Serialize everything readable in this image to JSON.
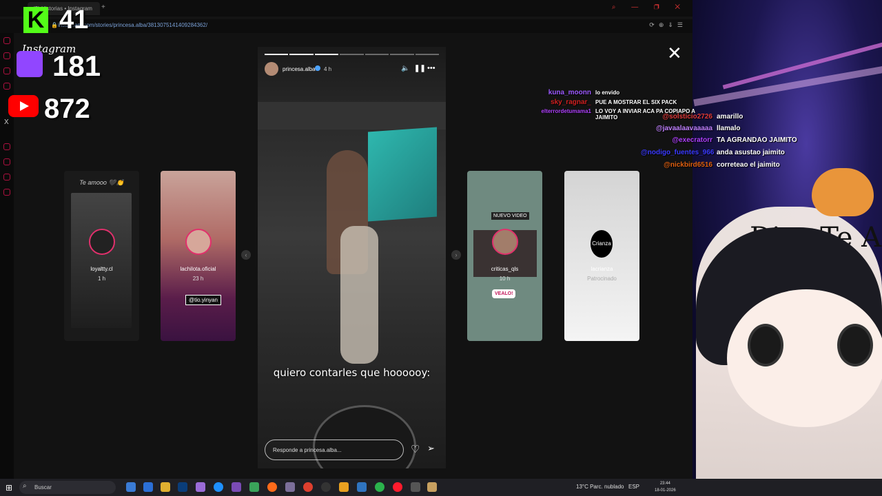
{
  "browser": {
    "tab_title": "(3) Historias • Instagram",
    "url": "instagram.com/stories/princesa.alba/3813075141409284362/"
  },
  "instagram": {
    "logo_text": "Instagram"
  },
  "side_stories": {
    "left": [
      {
        "name": "loyaltty.cl",
        "time": "1 h",
        "top_text": "Te amooo 🖤👏"
      },
      {
        "name": "lachilota.oficial",
        "time": "23 h",
        "tag": "@tio.yinyan"
      }
    ],
    "right": [
      {
        "name": "criticas_qls",
        "time": "10 h",
        "tag": "NUEVO VIDEO",
        "button": "VEALO!"
      },
      {
        "name": "lacrianza",
        "time": "Patrocinado",
        "logo": "Crianza"
      }
    ]
  },
  "story": {
    "username": "princesa.alba",
    "time": "4 h",
    "caption": "quiero contarles que hoooooy:",
    "reply_placeholder": "Responde a princesa.alba...",
    "segments_total": 7,
    "segments_done": 3
  },
  "overlay": {
    "kick_letter": "K",
    "kick_count": "41",
    "twitch_count": "181",
    "youtube_count": "872",
    "x_label": "X"
  },
  "chat": [
    {
      "name": "kuna_moonn",
      "message": "lo envido",
      "color": "#9b59ff"
    },
    {
      "name": "sky_ragnar_",
      "message": "PUE A MOSTRAR EL SIX PACK",
      "color": "#d02020"
    },
    {
      "name": "elterrordetumama1",
      "message": "LO VOY A INVIAR ACA PA COPIAPO A JAIMITO",
      "color": "#b040ff"
    },
    {
      "name": "@solsticio2726",
      "message": "amarillo",
      "color": "#e03a3a"
    },
    {
      "name": "@javaalaavaaaaa",
      "message": "llamalo",
      "color": "#c080ff"
    },
    {
      "name": "@execratorr",
      "message": "TA AGRANDAO JAIMITO",
      "color": "#b040ff"
    },
    {
      "name": "@nodigo_fuentes_966",
      "message": "anda asustao jaimito",
      "color": "#3a3aff"
    },
    {
      "name": "@nickbird6516",
      "message": "correteao el jaimito",
      "color": "#e06010"
    }
  ],
  "vtuber": {
    "banner_text": "Dios Te A"
  },
  "taskbar": {
    "search_placeholder": "Buscar",
    "weather": "13°C  Parc. nublado",
    "language": "ESP",
    "time": "23:44",
    "date": "18-01-2026"
  },
  "colors": {
    "kick": "#53fc18",
    "twitch": "#9146ff",
    "youtube": "#ff0000",
    "opera": "#ff1b2d"
  }
}
